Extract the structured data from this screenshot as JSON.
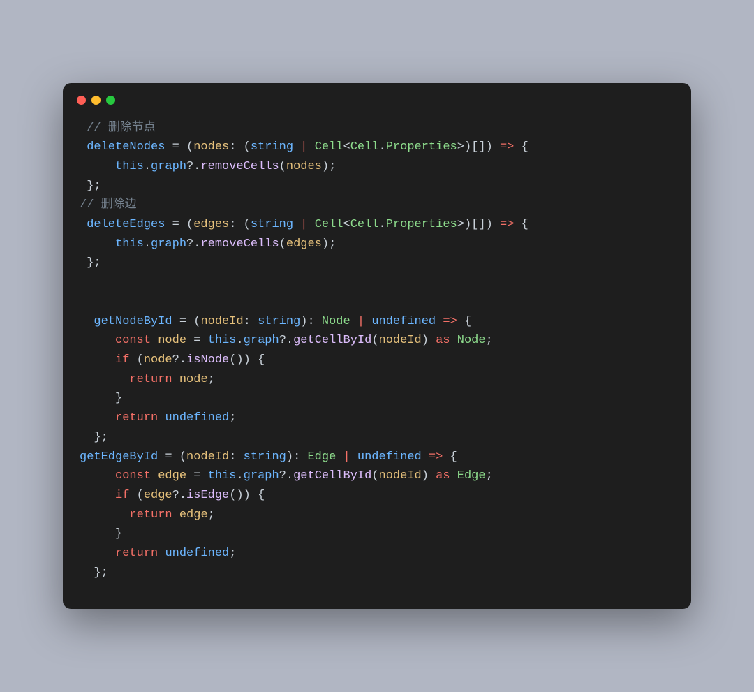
{
  "window": {
    "dots": [
      "red",
      "yellow",
      "green"
    ]
  },
  "code": {
    "comment_deleteNodes": " // 删除节点",
    "comment_deleteEdges": "// 删除边",
    "tokens": {
      "deleteNodes": "deleteNodes",
      "deleteEdges": "deleteEdges",
      "getNodeById": "getNodeById",
      "getEdgeById": "getEdgeById",
      "eq": " = ",
      "lparen": "(",
      "rparen": ")",
      "nodes": "nodes",
      "edges": "edges",
      "colon": ": ",
      "string": "string",
      "pipe": " | ",
      "Cell": "Cell",
      "lt": "<",
      "gt": ">",
      "dot": ".",
      "Properties": "Properties",
      "arr": ")[]",
      "arrow": " => ",
      "lbrace": "{",
      "rbrace": "}",
      "this": "this",
      "graph": "graph",
      "optchain": "?.",
      "removeCells": "removeCells",
      "semi": ";",
      "nodeId": "nodeId",
      "Node": "Node",
      "Edge": "Edge",
      "undefined": "undefined",
      "const": "const",
      "node": "node",
      "edge": "edge",
      "getCellById": "getCellById",
      "as": " as ",
      "if": "if",
      "isNode": "isNode",
      "isEdge": "isEdge",
      "return": "return",
      "sp": " "
    }
  }
}
